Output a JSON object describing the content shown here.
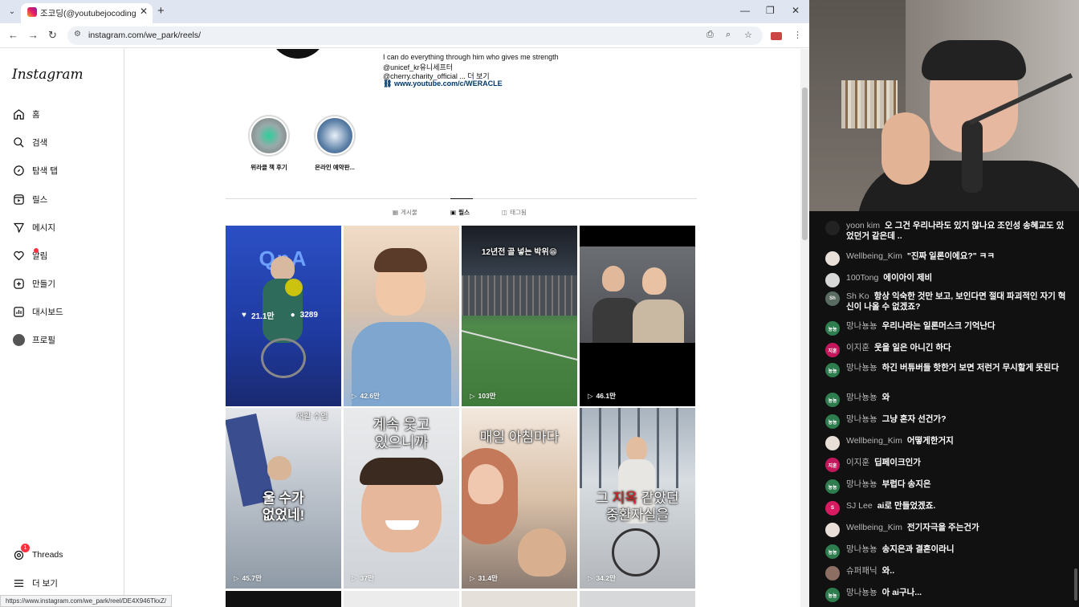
{
  "browser": {
    "tab_title": "조코딩(@youtubejocoding) • I",
    "url": "instagram.com/we_park/reels/",
    "status_url": "https://www.instagram.com/we_park/reel/DE4X946TkxZ/"
  },
  "ig": {
    "logo": "Instagram",
    "nav": [
      {
        "label": "홈",
        "icon": "home-icon"
      },
      {
        "label": "검색",
        "icon": "search-icon"
      },
      {
        "label": "탐색 탭",
        "icon": "compass-icon"
      },
      {
        "label": "릴스",
        "icon": "reels-icon"
      },
      {
        "label": "메시지",
        "icon": "send-icon"
      },
      {
        "label": "알림",
        "icon": "heart-icon"
      },
      {
        "label": "만들기",
        "icon": "plus-square-icon"
      },
      {
        "label": "대시보드",
        "icon": "chart-icon"
      },
      {
        "label": "프로필",
        "icon": "avatar-icon"
      }
    ],
    "threads_label": "Threads",
    "threads_badge": "1",
    "more_label": "더 보기",
    "bio": {
      "line1": "I can do everything through him who gives me strength",
      "line2": "@unicef_kr유니세프터",
      "line3": "@cherry.charity_official ... 더 보기",
      "link": "www.youtube.com/c/WERACLE"
    },
    "highlights": [
      {
        "label": "위라클 책 후기"
      },
      {
        "label": "온라인 예약판..."
      }
    ],
    "tabs": [
      {
        "label": "게시물",
        "active": false
      },
      {
        "label": "릴스",
        "active": true
      },
      {
        "label": "태그됨",
        "active": false
      }
    ],
    "reels": [
      {
        "views": "",
        "likes": "21.1만",
        "comments": "3289",
        "caption": "QnA"
      },
      {
        "views": "42.6만",
        "caption": ""
      },
      {
        "views": "103만",
        "caption": "12년전 골 넣는 박위😁"
      },
      {
        "views": "46.1만",
        "caption": ""
      },
      {
        "views": "45.7만",
        "caption": "울 수가\n없었네!"
      },
      {
        "views": "37만",
        "caption": "계속 웃고\n있으니까"
      },
      {
        "views": "31.4만",
        "caption": "매일 아침마다"
      },
      {
        "views": "34.2만",
        "caption_a": "그 ",
        "caption_b": "지옥",
        "caption_c": " 같았던\n중환자실을"
      }
    ],
    "reel5_overlay": "재활 수업"
  },
  "chat": {
    "messages": [
      {
        "name": "yoon kim",
        "text": "오 그건 우리나라도 있지 않나요 조인성 송혜교도 있었던거 같은데 ..",
        "avatar_color": "#222222",
        "initials": ""
      },
      {
        "name": "Wellbeing_Kim",
        "text": "\"진짜 일론이에요?\" ㅋㅋ",
        "avatar_color": "#e8e0d8",
        "initials": ""
      },
      {
        "name": "100Tong",
        "text": "에이아이 제비",
        "avatar_color": "#d8d8d8",
        "initials": ""
      },
      {
        "name": "Sh Ko",
        "text": "항상 익숙한 것만 보고, 보인다면 절대 파괴적인 자기 혁신이 나올 수 없겠죠?",
        "avatar_color": "#5a6b62",
        "initials": "Sh"
      },
      {
        "name": "망나뇽뇽",
        "text": "우리나라는 일론머스크 기억난다",
        "avatar_color": "#2e7d4f",
        "initials": "뇽뇽"
      },
      {
        "name": "이지훈",
        "text": "웃을 일은 아니긴 하다",
        "avatar_color": "#c2185b",
        "initials": "지훈"
      },
      {
        "name": "망나뇽뇽",
        "text": "하긴 버튜버들 핫한거 보면 저런거 무시할게 못된다",
        "avatar_color": "#2e7d4f",
        "initials": "뇽뇽"
      },
      {
        "name": "망나뇽뇽",
        "text": "와",
        "avatar_color": "#2e7d4f",
        "initials": "뇽뇽"
      },
      {
        "name": "망나뇽뇽",
        "text": "그냥 혼자 선건가?",
        "avatar_color": "#2e7d4f",
        "initials": "뇽뇽"
      },
      {
        "name": "Wellbeing_Kim",
        "text": "어떻게한거지",
        "avatar_color": "#e8e0d8",
        "initials": ""
      },
      {
        "name": "이지훈",
        "text": "딥페이크인가",
        "avatar_color": "#c2185b",
        "initials": "지훈"
      },
      {
        "name": "망나뇽뇽",
        "text": "부럽다 송지은",
        "avatar_color": "#2e7d4f",
        "initials": "뇽뇽"
      },
      {
        "name": "SJ Lee",
        "text": "ai로 만들었겠죠.",
        "avatar_color": "#d81b60",
        "initials": "S"
      },
      {
        "name": "Wellbeing_Kim",
        "text": "전기자극을 주는건가",
        "avatar_color": "#e8e0d8",
        "initials": ""
      },
      {
        "name": "망나뇽뇽",
        "text": "송지은과 결혼이라니",
        "avatar_color": "#2e7d4f",
        "initials": "뇽뇽"
      },
      {
        "name": "슈퍼패닉",
        "text": "와..",
        "avatar_color": "#8d6e63",
        "initials": ""
      },
      {
        "name": "망나뇽뇽",
        "text": "아 ai구나...",
        "avatar_color": "#2e7d4f",
        "initials": "뇽뇽"
      }
    ]
  }
}
